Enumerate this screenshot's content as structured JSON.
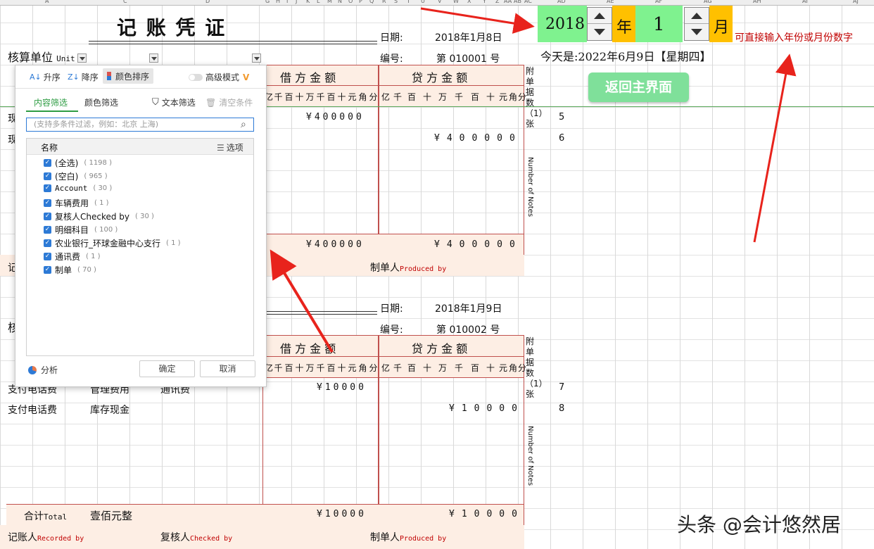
{
  "column_headers": [
    "A",
    "C",
    "D",
    "G",
    "H",
    "I",
    "J",
    "K",
    "L",
    "M",
    "N",
    "O",
    "P",
    "Q",
    "R",
    "S",
    "T",
    "U",
    "V",
    "W",
    "X",
    "Y",
    "Z",
    "AA",
    "AB",
    "AC",
    "AD",
    "AE",
    "AF",
    "AG",
    "AH",
    "AI",
    "AJ"
  ],
  "voucher": {
    "title": "记 账 凭 证",
    "unit_label": "核算单位",
    "unit_label_en": "Unit",
    "debit_header": "借 方 金 额",
    "credit_header": "贷 方 金 额",
    "digit_headers": [
      "亿",
      "千",
      "百",
      "十",
      "万",
      "千",
      "百",
      "十",
      "元",
      "角",
      "分"
    ],
    "attach_label": "附单据数（1）张",
    "attach_label_en": "Number of Notes",
    "producer_label": "制单人",
    "producer_label_en": "Produced by",
    "recorder_label": "记账人",
    "recorder_label_en": "Recorded by",
    "checker_label": "复核人",
    "checker_label_en": "Checked by",
    "total_label": "合计",
    "total_label_en": "Total",
    "first": {
      "date_label": "日期:",
      "date_value": "2018年1月8日",
      "number_label": "编号:",
      "number_value": "第 010001 号",
      "row1_summary": "现",
      "row2_summary": "现",
      "row1_debit": "¥400000",
      "row2_credit": "¥400000",
      "total_debit": "¥400000",
      "total_credit": "¥400000",
      "row_numbers": [
        "5",
        "6"
      ],
      "recorder_partial": "记"
    },
    "second": {
      "date_label": "日期:",
      "date_value": "2018年1月9日",
      "number_label": "编号:",
      "number_value": "第 010002 号",
      "unit_partial": "核",
      "row1_summary": "支付电话费",
      "row1_account": "管理费用",
      "row1_detail": "通讯费",
      "row2_summary": "支付电话费",
      "row2_account": "库存现金",
      "row1_debit": "¥10000",
      "row2_credit": "¥10000",
      "total_amount_words": "壹佰元整",
      "total_debit": "¥10000",
      "total_credit": "¥10000",
      "row_numbers": [
        "7",
        "8"
      ]
    }
  },
  "control": {
    "year_value": "2018",
    "year_unit": "年",
    "month_value": "1",
    "month_unit": "月",
    "hint": "可直接输入年份或月份数字",
    "today": "今天是:2022年6月9日【星期四】",
    "home_button": "返回主界面"
  },
  "filter_panel": {
    "sort_asc": "升序",
    "sort_desc": "降序",
    "sort_color": "颜色排序",
    "advanced_mode": "高级模式",
    "tab_content": "内容筛选",
    "tab_color": "颜色筛选",
    "text_filter": "文本筛选",
    "clear": "清空条件",
    "search_placeholder": "(支持多条件过滤，例如：北京  上海)",
    "list_header": "名称",
    "options_label": "选项",
    "items": [
      {
        "label": "(全选)",
        "count": "( 1198 )"
      },
      {
        "label": "(空白)",
        "count": "( 965 )"
      },
      {
        "label": "Account",
        "count": "( 30 )"
      },
      {
        "label": "车辆费用",
        "count": "( 1 )"
      },
      {
        "label": "复核人Checked by",
        "count": "( 30 )"
      },
      {
        "label": "明细科目",
        "count": "( 100 )"
      },
      {
        "label": "农业银行_环球金融中心支行",
        "count": "( 1 )"
      },
      {
        "label": "通讯费",
        "count": "( 1 )"
      },
      {
        "label": "制单",
        "count": "( 70 )"
      }
    ],
    "analyze": "分析",
    "ok": "确定",
    "cancel": "取消"
  },
  "watermark": "头条 @会计悠然居",
  "colors": {
    "accent_red": "#c00000",
    "peach": "#fdeee4",
    "green_box": "#7ff28f",
    "orange": "#ffc000",
    "button_green": "#7fe09a"
  }
}
